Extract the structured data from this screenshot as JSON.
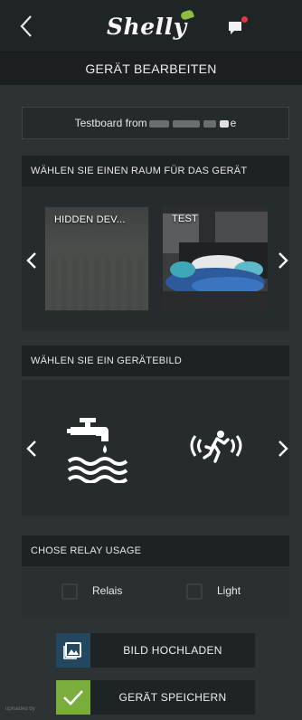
{
  "header": {
    "logo_text": "Shelly",
    "back_icon": "chevron-left-icon",
    "notification_icon": "chat-bubble-icon",
    "notification_dot_color": "#e03a3a"
  },
  "title": "GERÄT BEARBEITEN",
  "device_name": {
    "prefix": "Testboard from",
    "suffix": "e"
  },
  "room_section": {
    "header": "WÄHLEN SIE EINEN RAUM FÜR DAS GERÄT",
    "rooms": [
      {
        "label": "HIDDEN DEV..."
      },
      {
        "label": "TEST"
      }
    ]
  },
  "image_section": {
    "header": "WÄHLEN SIE EIN GERÄTEBILD",
    "images": [
      {
        "icon": "faucet-water-icon"
      },
      {
        "icon": "motion-sensor-icon"
      }
    ]
  },
  "relay_section": {
    "header": "CHOSE RELAY USAGE",
    "options": [
      {
        "label": "Relais",
        "checked": false
      },
      {
        "label": "Light",
        "checked": false
      }
    ]
  },
  "buttons": {
    "upload": "BILD HOCHLADEN",
    "save": "GERÄT SPEICHERN"
  },
  "colors": {
    "accent_green": "#79ad3c",
    "accent_blue": "#23475e",
    "background": "#2d3335"
  },
  "watermark": "uploaded by"
}
